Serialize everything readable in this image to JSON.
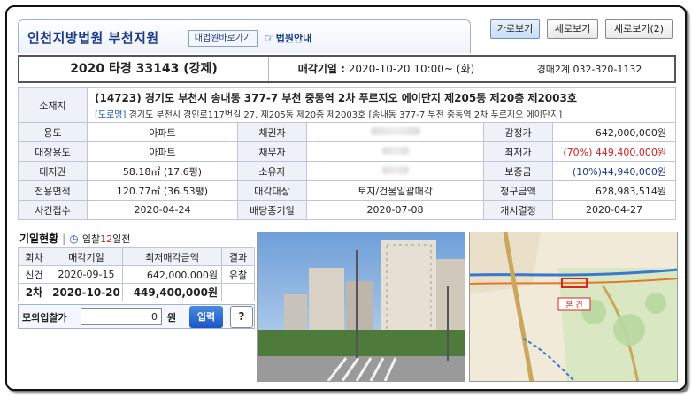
{
  "header": {
    "court_title": "인천지방법원 부천지원",
    "court_link": "대법원바로가기",
    "guide_link": "법원안내",
    "view_buttons": [
      "가로보기",
      "세로보기",
      "세로보기(2)"
    ]
  },
  "case": {
    "number": "2020 타경 33143 (강제)",
    "date_label": "매각기일 :",
    "date_value": "2020-10-20 10:00~ (화)",
    "contact": "경매2계 032-320-1132"
  },
  "property": {
    "address_label": "소재지",
    "address_main": "(14723) 경기도 부천시 송내동 377-7 부천 중동역 2차 푸르지오 에이단지 제205동 제20층 제2003호",
    "road_tag": "[도로명]",
    "address_road": "경기도 부천시 경인로117번길 27, 제205동 제20층 제2003호 [송내동 377-7 부천 중동역 2차 푸르지오 에이단지]",
    "rows": [
      {
        "l1": "용도",
        "v1": "아파트",
        "l2": "채권자",
        "v2": "",
        "l3": "감정가",
        "v3": "642,000,000원"
      },
      {
        "l1": "대장용도",
        "v1": "아파트",
        "l2": "채무자",
        "v2": "",
        "l3": "최저가",
        "v3": "(70%) 449,400,000원"
      },
      {
        "l1": "대지권",
        "v1": "58.18㎡ (17.6평)",
        "l2": "소유자",
        "v2": "",
        "l3": "보증금",
        "v3": "(10%)44,940,000원"
      },
      {
        "l1": "전용면적",
        "v1": "120.77㎡ (36.53평)",
        "l2": "매각대상",
        "v2": "토지/건물일괄매각",
        "l3": "청구금액",
        "v3": "628,983,514원"
      },
      {
        "l1": "사건접수",
        "v1": "2020-04-24",
        "l2": "배당종기일",
        "v2": "2020-07-08",
        "l3": "개시결정",
        "v3": "2020-04-27"
      }
    ]
  },
  "history": {
    "title": "기일현황",
    "days_prefix": "입찰",
    "days_num": "12",
    "days_suffix": "일전",
    "headers": [
      "회차",
      "매각기일",
      "최저매각금액",
      "결과"
    ],
    "rows": [
      {
        "round": "신건",
        "date": "2020-09-15",
        "price": "642,000,000원",
        "result": "유찰"
      },
      {
        "round": "2차",
        "date": "2020-10-20",
        "price": "449,400,000원",
        "result": ""
      }
    ]
  },
  "mock_bid": {
    "label": "모의입찰가",
    "value": "0",
    "unit": "원",
    "bid_button": "입력",
    "help_button": "?"
  },
  "map": {
    "tag": "본 건"
  }
}
